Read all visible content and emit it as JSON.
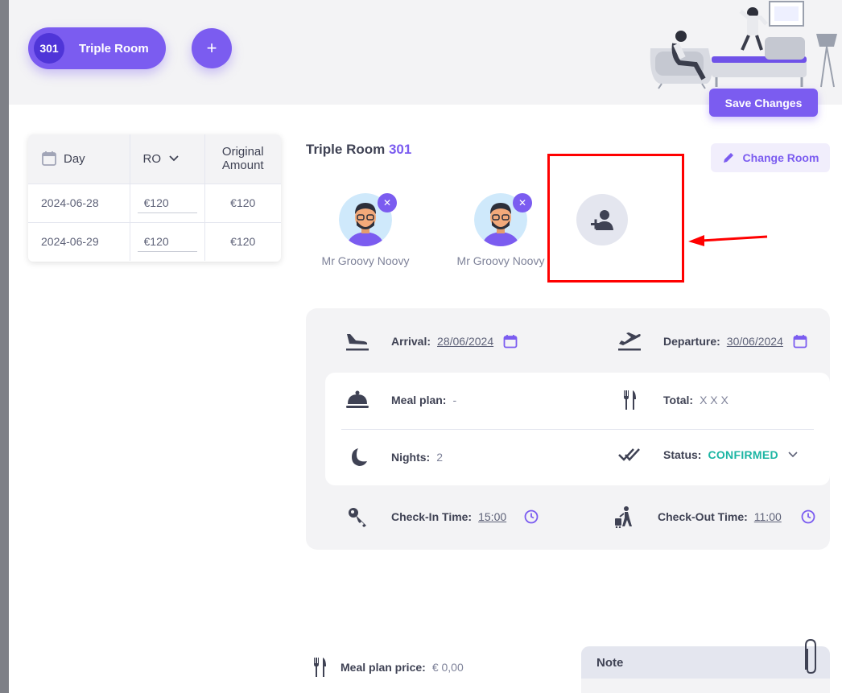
{
  "top_bar": {
    "room_number": "301",
    "room_name": "Triple Room",
    "add_room_symbol": "+",
    "save_label": "Save Changes"
  },
  "price_table": {
    "columns": {
      "day": "Day",
      "plan": "RO",
      "original": "Original Amount"
    },
    "rows": [
      {
        "day": "2024-06-28",
        "price": "€120",
        "original": "€120"
      },
      {
        "day": "2024-06-29",
        "price": "€120",
        "original": "€120"
      }
    ]
  },
  "room_header": {
    "title": "Triple Room",
    "number": "301",
    "change_room_label": "Change Room"
  },
  "guests": [
    {
      "name": "Mr Groovy Noovy"
    },
    {
      "name": "Mr Groovy Noovy"
    }
  ],
  "details": {
    "arrival_label": "Arrival:",
    "arrival_value": "28/06/2024",
    "departure_label": "Departure:",
    "departure_value": "30/06/2024",
    "meal_plan_label": "Meal plan:",
    "meal_plan_value": "-",
    "total_label": "Total:",
    "total_value": "X X X",
    "nights_label": "Nights:",
    "nights_value": "2",
    "status_label": "Status:",
    "status_value": "CONFIRMED",
    "checkin_label": "Check-In Time:",
    "checkin_value": "15:00",
    "checkout_label": "Check-Out Time:",
    "checkout_value": "11:00"
  },
  "meal_price": {
    "label": "Meal plan price:",
    "value": "€ 0,00"
  },
  "note": {
    "title": "Note"
  },
  "colors": {
    "accent": "#7b5cf0",
    "status_confirmed": "#1bb5a3",
    "highlight": "#ff0000"
  }
}
